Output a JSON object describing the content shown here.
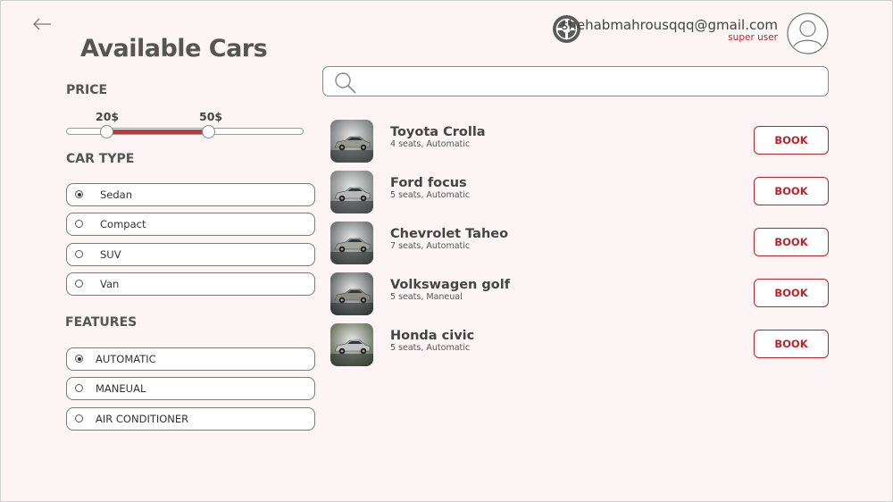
{
  "page": {
    "title": "Available Cars"
  },
  "user": {
    "email": "shehabmahrousqqq@gmail.com",
    "role": "super user"
  },
  "search": {
    "value": "",
    "placeholder": ""
  },
  "filters": {
    "price": {
      "heading": "PRICE",
      "min_label": "20$",
      "max_label": "50$",
      "range_fraction": [
        0.17,
        0.6
      ]
    },
    "car_type": {
      "heading": "CAR TYPE",
      "options": [
        {
          "label": "Sedan",
          "checked": true
        },
        {
          "label": "Compact",
          "checked": false
        },
        {
          "label": "SUV",
          "checked": false
        },
        {
          "label": "Van",
          "checked": false
        }
      ]
    },
    "features": {
      "heading": "FEATURES",
      "options": [
        {
          "label": "AUTOMATIC",
          "checked": true
        },
        {
          "label": "MANEUAL",
          "checked": false
        },
        {
          "label": "AIR CONDITIONER",
          "checked": false
        }
      ]
    }
  },
  "cars": [
    {
      "name": "Toyota Crolla",
      "specs": "4 seats, Automatic",
      "book_label": "BOOK",
      "body_color": "#9a9a8c"
    },
    {
      "name": "Ford focus",
      "specs": "5 seats, Automatic",
      "book_label": "BOOK",
      "body_color": "#b8b8b8"
    },
    {
      "name": "Chevrolet Taheo",
      "specs": "7 seats, Automatic",
      "book_label": "BOOK",
      "body_color": "#a3a396"
    },
    {
      "name": "Volkswagen golf",
      "specs": "5 seats, Maneual",
      "book_label": "BOOK",
      "body_color": "#8c8c80"
    },
    {
      "name": "Honda civic",
      "specs": "5 seats, Automatic",
      "book_label": "BOOK",
      "body_color": "#c4c4c4"
    }
  ],
  "colors": {
    "accent": "#b3282d",
    "slider_fill": "#c0393c",
    "background": "#fdf5f5",
    "text": "#555555"
  },
  "icons": {
    "back": "arrow-left-icon",
    "settings": "wheel-icon",
    "avatar": "user-avatar-icon",
    "search": "search-icon"
  }
}
